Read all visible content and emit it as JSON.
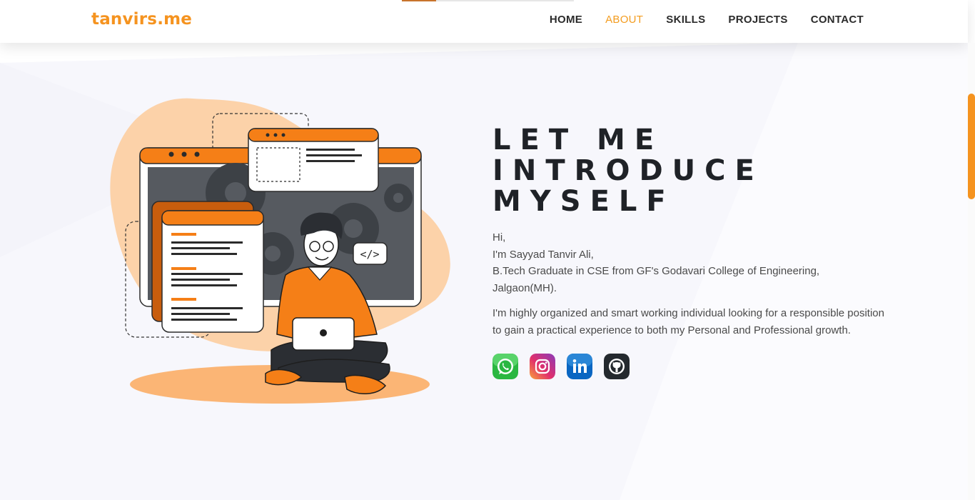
{
  "header": {
    "logo": "tanvirs.me",
    "scroll_progress": 0.2,
    "nav": [
      {
        "label": "HOME",
        "active": false
      },
      {
        "label": "ABOUT",
        "active": true
      },
      {
        "label": "SKILLS",
        "active": false
      },
      {
        "label": "PROJECTS",
        "active": false
      },
      {
        "label": "CONTACT",
        "active": false
      }
    ]
  },
  "about": {
    "heading_lines": [
      "LET ME",
      "INTRODUCE",
      "MYSELF"
    ],
    "intro_lines": [
      "Hi,",
      "I'm Sayyad Tanvir Ali,",
      "B.Tech Graduate in CSE from GF's Godavari College of Engineering,",
      "Jalgaon(MH)."
    ],
    "bio": "I'm highly organized and smart working individual looking for a responsible position to gain a practical experience to both my Personal and Professional growth.",
    "socials": [
      {
        "icon": "whatsapp-icon",
        "color": "#25d366"
      },
      {
        "icon": "instagram-icon",
        "color": "#c13584"
      },
      {
        "icon": "linkedin-icon",
        "color": "#0a66c2"
      },
      {
        "icon": "github-icon",
        "color": "#24292e"
      }
    ]
  },
  "colors": {
    "accent": "#f5931f",
    "nav_active": "#f39c1f",
    "heading": "#1f2227"
  }
}
